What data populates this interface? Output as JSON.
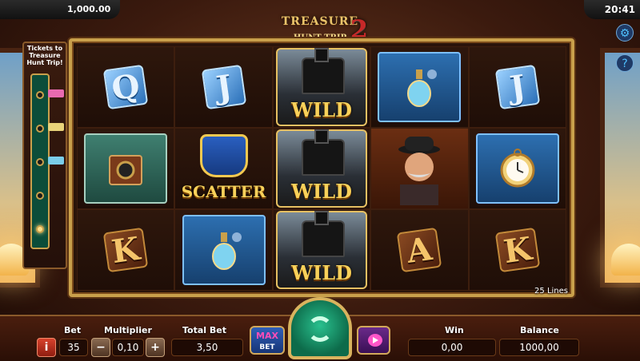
{
  "header": {
    "balance_display": "1,000.00",
    "clock": "20:41"
  },
  "logo": {
    "line1": "TREASURE",
    "line2": "HUNT TRIP",
    "number": "2"
  },
  "progress": {
    "title": "Tickets to Treasure Hunt Trip!"
  },
  "reels": {
    "lines_label": "25 Lines",
    "wild_label": "WILD",
    "scatter_label": "SCATTER",
    "cells": [
      [
        "Q",
        "J",
        "WILD",
        "perfume",
        "J"
      ],
      [
        "camera",
        "SCATTER",
        "WILD",
        "detective",
        "pocket-watch"
      ],
      [
        "K",
        "perfume",
        "WILD",
        "A",
        "K"
      ]
    ]
  },
  "controls": {
    "bet_label": "Bet",
    "bet_value": "35",
    "multiplier_label": "Multiplier",
    "multiplier_value": "0,10",
    "total_bet_label": "Total Bet",
    "total_bet_value": "3,50",
    "max_bet_line1": "MAX",
    "max_bet_line2": "BET",
    "win_label": "Win",
    "win_value": "0,00",
    "balance_label": "Balance",
    "balance_value": "1000,00",
    "info_glyph": "i",
    "minus_glyph": "−",
    "plus_glyph": "+"
  },
  "colors": {
    "gold": "#c9a04b",
    "spin_green": "#29c08e",
    "max_blue": "#2f5fb8"
  }
}
